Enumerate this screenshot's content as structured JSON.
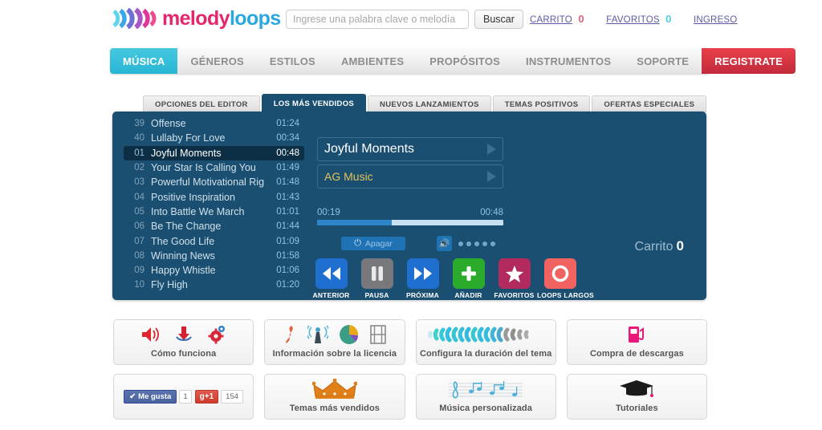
{
  "header": {
    "logo": {
      "part1": "melody",
      "part2": "loops"
    },
    "search": {
      "placeholder": "Ingrese una palabra clave o melodía",
      "value": "",
      "button_label": "Buscar"
    },
    "links": [
      {
        "label": "CARRITO",
        "count": "0",
        "count_color": "#e8607f"
      },
      {
        "label": "FAVORITOS",
        "count": "0",
        "count_color": "#4ad0e8"
      },
      {
        "label": "INGRESO",
        "count": "",
        "count_color": ""
      }
    ]
  },
  "nav": {
    "items": [
      {
        "label": "MÚSICA",
        "state": "active"
      },
      {
        "label": "GÉNEROS",
        "state": "normal"
      },
      {
        "label": "ESTILOS",
        "state": "normal"
      },
      {
        "label": "AMBIENTES",
        "state": "normal"
      },
      {
        "label": "PROPÓSITOS",
        "state": "normal"
      },
      {
        "label": "INSTRUMENTOS",
        "state": "normal"
      },
      {
        "label": "SOPORTE",
        "state": "normal"
      }
    ],
    "signup_label": "REGISTRATE"
  },
  "subtabs": [
    {
      "label": "OPCIONES DEL EDITOR",
      "active": false
    },
    {
      "label": "LOS MÁS VENDIDOS",
      "active": true
    },
    {
      "label": "NUEVOS LANZAMIENTOS",
      "active": false
    },
    {
      "label": "TEMAS POSITIVOS",
      "active": false
    },
    {
      "label": "OFERTAS ESPECIALES",
      "active": false
    }
  ],
  "player": {
    "tracks": [
      {
        "num": "39",
        "title": "Offense",
        "duration": "01:24",
        "current": false
      },
      {
        "num": "40",
        "title": "Lullaby For Love",
        "duration": "00:34",
        "current": false
      },
      {
        "num": "01",
        "title": "Joyful Moments",
        "duration": "00:48",
        "current": true
      },
      {
        "num": "02",
        "title": "Your Star Is Calling You",
        "duration": "01:49",
        "current": false
      },
      {
        "num": "03",
        "title": "Powerful Motivational Rig",
        "duration": "01:48",
        "current": false
      },
      {
        "num": "04",
        "title": "Positive Inspiration",
        "duration": "01:43",
        "current": false
      },
      {
        "num": "05",
        "title": "Into Battle We March",
        "duration": "01:01",
        "current": false
      },
      {
        "num": "06",
        "title": "Be The Change",
        "duration": "01:44",
        "current": false
      },
      {
        "num": "07",
        "title": "The Good Life",
        "duration": "01:09",
        "current": false
      },
      {
        "num": "08",
        "title": "Winning News",
        "duration": "01:58",
        "current": false
      },
      {
        "num": "09",
        "title": "Happy Whistle",
        "duration": "01:06",
        "current": false
      },
      {
        "num": "10",
        "title": "Fly High",
        "duration": "01:20",
        "current": false
      }
    ],
    "now_playing": {
      "title": "Joyful Moments",
      "artist": "AG Music"
    },
    "progress": {
      "elapsed": "00:19",
      "total": "00:48",
      "percent": 40
    },
    "mute_button": {
      "label": "Apagar"
    },
    "volume": {
      "level": 5,
      "max": 5
    },
    "controls": [
      {
        "label": "ANTERIOR",
        "icon": "rewind-icon",
        "color": "blue"
      },
      {
        "label": "PAUSA",
        "icon": "pause-icon",
        "color": "gray"
      },
      {
        "label": "PRÓXIMA",
        "icon": "forward-icon",
        "color": "blue"
      },
      {
        "label": "AÑADIR",
        "icon": "plus-icon",
        "color": "green"
      },
      {
        "label": "FAVORITOS",
        "icon": "star-icon",
        "color": "pink"
      },
      {
        "label": "LOOPS LARGOS",
        "icon": "circle-icon",
        "color": "red"
      }
    ],
    "cart": {
      "label": "Carrito",
      "count": "0"
    }
  },
  "tiles": [
    [
      {
        "label": "Cómo funciona",
        "icons": [
          "speaker-icon",
          "download-icon",
          "gear-icon"
        ]
      },
      {
        "label": "Información sobre la licencia",
        "icons": [
          "flash-icon",
          "broadcast-tower-icon",
          "pie-chart-icon",
          "film-icon"
        ]
      },
      {
        "label": "Configura la duración del tema",
        "icons": [
          "waveform-icon"
        ]
      },
      {
        "label": "Compra de descargas",
        "icons": [
          "fuel-pump-icon"
        ]
      }
    ],
    [
      {
        "label": "",
        "icons": [
          "facebook-like-icon",
          "google-plus-icon"
        ]
      },
      {
        "label": "Temas más vendidos",
        "icons": [
          "crown-icon"
        ]
      },
      {
        "label": "Música personalizada",
        "icons": [
          "music-staff-icon"
        ]
      },
      {
        "label": "Tutoriales",
        "icons": [
          "graduation-cap-icon"
        ]
      }
    ]
  ],
  "social": {
    "facebook": {
      "label": "Me gusta",
      "count": "1"
    },
    "google": {
      "label": "g+1",
      "count": "154"
    }
  }
}
